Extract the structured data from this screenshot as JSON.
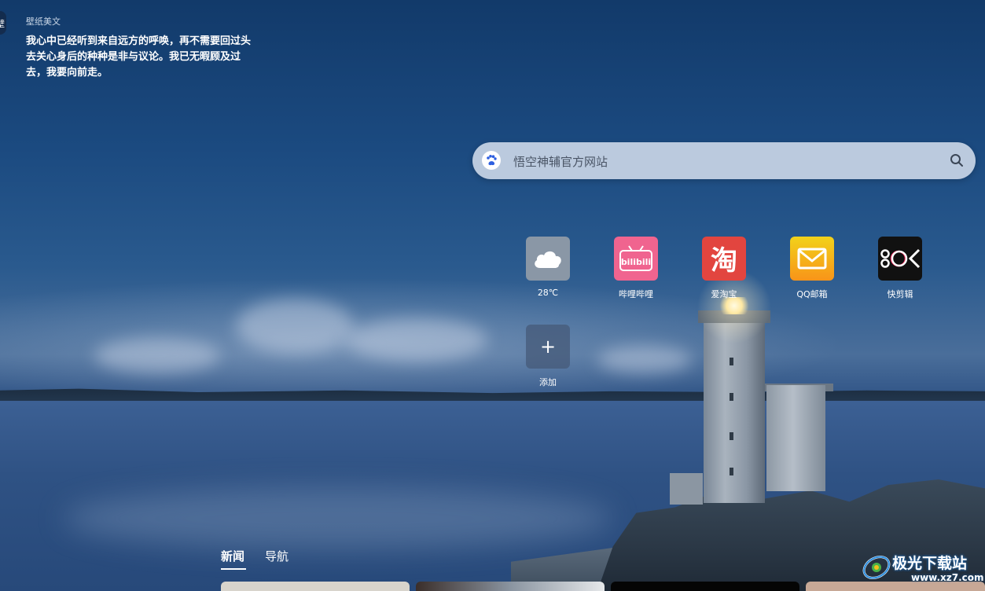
{
  "wallpaper_text": {
    "title": "壁纸美文",
    "body": "我心中已经听到来自远方的呼唤，再不需要回过头去关心身后的种种是非与议论。我已无暇顾及过去，我要向前走。"
  },
  "edge_tab_glyph": "壁",
  "search": {
    "engine_icon": "baidu-paw-icon",
    "placeholder": "悟空神辅官方网站",
    "value": "",
    "button_icon": "search-icon"
  },
  "shortcuts": [
    {
      "label": "28℃",
      "icon": "cloud-icon",
      "bg": "#8a97a6"
    },
    {
      "label": "哔哩哔哩",
      "icon": "bilibili-icon",
      "bg": "#f0648f"
    },
    {
      "label": "爱淘宝",
      "icon": "taobao-icon",
      "bg": "#e2453f"
    },
    {
      "label": "QQ邮箱",
      "icon": "mail-icon",
      "bg": "#f6a21b"
    },
    {
      "label": "快剪辑",
      "icon": "kuaijianji-icon",
      "bg": "#111111"
    }
  ],
  "add_shortcut": {
    "label": "添加",
    "glyph": "+"
  },
  "tabs": [
    {
      "label": "新闻",
      "active": true
    },
    {
      "label": "导航",
      "active": false
    }
  ],
  "watermark": {
    "brand": "极光下载站",
    "url": "www.xz7.com"
  }
}
